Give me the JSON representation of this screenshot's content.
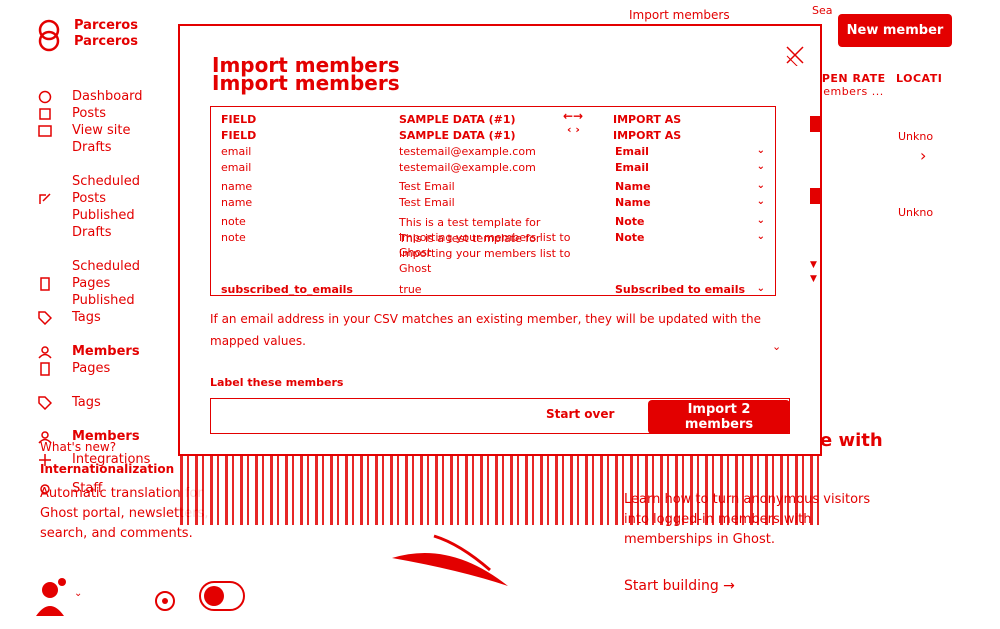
{
  "brand": {
    "line1": "Parceros",
    "line2": "Parceros"
  },
  "sidebar": {
    "items": [
      {
        "label": "Dashboard",
        "icon": "dashboard-icon"
      },
      {
        "label": "Posts",
        "icon": "posts-icon"
      },
      {
        "label": "View site",
        "icon": "view-site-icon"
      },
      {
        "label": "Drafts",
        "icon": ""
      },
      {
        "label": "Scheduled",
        "icon": ""
      },
      {
        "label": "Posts",
        "icon": ""
      },
      {
        "label": "Published",
        "icon": "edit-icon"
      },
      {
        "label": "Drafts",
        "icon": ""
      },
      {
        "label": "Scheduled",
        "icon": ""
      },
      {
        "label": "Pages",
        "icon": "pages-icon"
      },
      {
        "label": "Published",
        "icon": ""
      },
      {
        "label": "Tags",
        "icon": "tag-icon"
      },
      {
        "label": "Members",
        "icon": "members-icon"
      },
      {
        "label": "Pages",
        "icon": "pages-icon"
      },
      {
        "label": "Tags",
        "icon": "tag-icon"
      },
      {
        "label": "Members",
        "icon": "members-icon"
      }
    ],
    "whats_new": "What's new?",
    "integrations": "Integrations",
    "staff": "Staff",
    "intl_title": "Internationalization",
    "intl_desc": "Automatic translation for Ghost portal, newsletters, search, and comments."
  },
  "header": {
    "import_link": "Import members",
    "search_fragment": "Sea",
    "new_member": "New member"
  },
  "columns": {
    "open_rate": "OPEN RATE",
    "open_rate_sub": "members ...",
    "location": "LOCATI"
  },
  "unknown": [
    "Unkno",
    "Unkno"
  ],
  "background": {
    "title_fragment": "e with",
    "promo": "Learn how to turn anonymous visitors into logged-in members with memberships in Ghost.",
    "start_building": "Start building →"
  },
  "modal": {
    "title": "Import members",
    "title_dup": "Import members",
    "headers": {
      "field": "FIELD",
      "sample": "SAMPLE DATA (#1)",
      "import_as": "IMPORT AS"
    },
    "rows": [
      {
        "field": "email",
        "sample": "testemail@example.com",
        "import_as": "Email"
      },
      {
        "field": "name",
        "sample": "Test Email",
        "import_as": "Name"
      },
      {
        "field": "note",
        "sample": "This is a test template for importing your members list to Ghost",
        "import_as": "Note"
      },
      {
        "field": "subscribed_to_emails",
        "sample": "true",
        "import_as": "Subscribed to emails"
      }
    ],
    "info": "If an email address in your CSV matches an existing member, they will be updated with the mapped values.",
    "label_title": "Label these members",
    "start_over": "Start over",
    "import_button": "Import 2 members"
  },
  "colors": {
    "accent": "#e30000",
    "background": "#ffffff"
  }
}
